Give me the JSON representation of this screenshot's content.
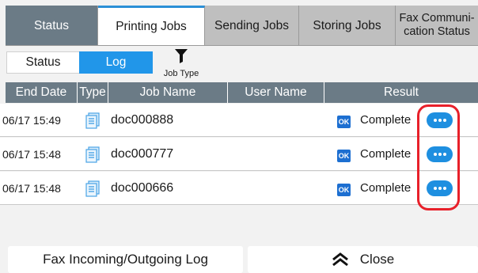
{
  "tabs": [
    {
      "label": "Status"
    },
    {
      "label": "Printing Jobs"
    },
    {
      "label": "Sending Jobs"
    },
    {
      "label": "Storing Jobs"
    },
    {
      "label": "Fax Communi-\ncation Status"
    }
  ],
  "view_toggle": {
    "status_label": "Status",
    "log_label": "Log",
    "selected": "Log"
  },
  "filter": {
    "label": "Job Type",
    "icon": "funnel-icon"
  },
  "table": {
    "headers": [
      "End Date",
      "Type",
      "Job Name",
      "User Name",
      "Result"
    ],
    "rows": [
      {
        "end_date": "06/17 15:49",
        "job_name": "doc000888",
        "user_name": "",
        "result": "Complete",
        "result_badge": "OK"
      },
      {
        "end_date": "06/17 15:48",
        "job_name": "doc000777",
        "user_name": "",
        "result": "Complete",
        "result_badge": "OK"
      },
      {
        "end_date": "06/17 15:48",
        "job_name": "doc000666",
        "user_name": "",
        "result": "Complete",
        "result_badge": "OK"
      }
    ]
  },
  "buttons": {
    "fax_log": "Fax Incoming/Outgoing Log",
    "close": "Close"
  },
  "colors": {
    "accent": "#2196e9",
    "header_bg": "#6b7b86",
    "highlight": "#e8202a",
    "ok_badge": "#1d6fd1"
  }
}
